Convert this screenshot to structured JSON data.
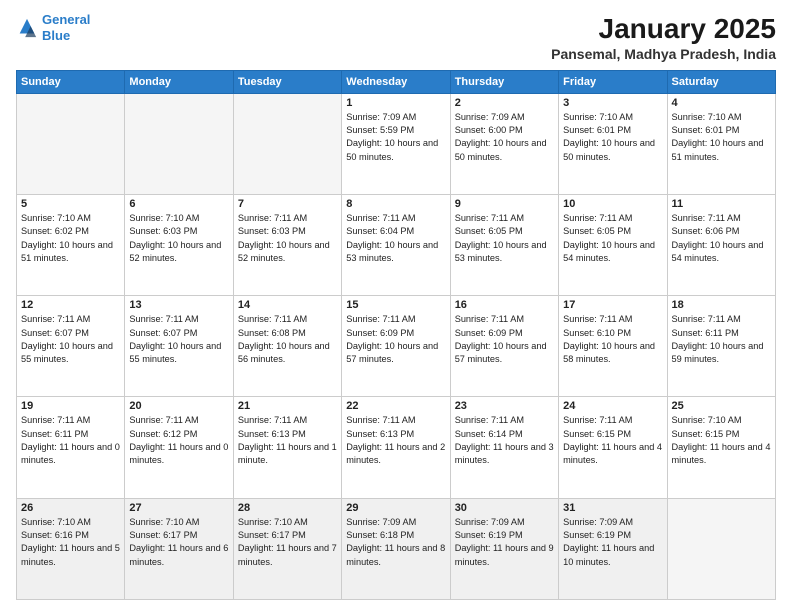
{
  "logo": {
    "line1": "General",
    "line2": "Blue"
  },
  "title": "January 2025",
  "location": "Pansemal, Madhya Pradesh, India",
  "weekdays": [
    "Sunday",
    "Monday",
    "Tuesday",
    "Wednesday",
    "Thursday",
    "Friday",
    "Saturday"
  ],
  "weeks": [
    [
      {
        "day": "",
        "empty": true
      },
      {
        "day": "",
        "empty": true
      },
      {
        "day": "",
        "empty": true
      },
      {
        "day": "1",
        "rise": "7:09 AM",
        "set": "5:59 PM",
        "daylight": "10 hours and 50 minutes."
      },
      {
        "day": "2",
        "rise": "7:09 AM",
        "set": "6:00 PM",
        "daylight": "10 hours and 50 minutes."
      },
      {
        "day": "3",
        "rise": "7:10 AM",
        "set": "6:01 PM",
        "daylight": "10 hours and 50 minutes."
      },
      {
        "day": "4",
        "rise": "7:10 AM",
        "set": "6:01 PM",
        "daylight": "10 hours and 51 minutes."
      }
    ],
    [
      {
        "day": "5",
        "rise": "7:10 AM",
        "set": "6:02 PM",
        "daylight": "10 hours and 51 minutes."
      },
      {
        "day": "6",
        "rise": "7:10 AM",
        "set": "6:03 PM",
        "daylight": "10 hours and 52 minutes."
      },
      {
        "day": "7",
        "rise": "7:11 AM",
        "set": "6:03 PM",
        "daylight": "10 hours and 52 minutes."
      },
      {
        "day": "8",
        "rise": "7:11 AM",
        "set": "6:04 PM",
        "daylight": "10 hours and 53 minutes."
      },
      {
        "day": "9",
        "rise": "7:11 AM",
        "set": "6:05 PM",
        "daylight": "10 hours and 53 minutes."
      },
      {
        "day": "10",
        "rise": "7:11 AM",
        "set": "6:05 PM",
        "daylight": "10 hours and 54 minutes."
      },
      {
        "day": "11",
        "rise": "7:11 AM",
        "set": "6:06 PM",
        "daylight": "10 hours and 54 minutes."
      }
    ],
    [
      {
        "day": "12",
        "rise": "7:11 AM",
        "set": "6:07 PM",
        "daylight": "10 hours and 55 minutes."
      },
      {
        "day": "13",
        "rise": "7:11 AM",
        "set": "6:07 PM",
        "daylight": "10 hours and 55 minutes."
      },
      {
        "day": "14",
        "rise": "7:11 AM",
        "set": "6:08 PM",
        "daylight": "10 hours and 56 minutes."
      },
      {
        "day": "15",
        "rise": "7:11 AM",
        "set": "6:09 PM",
        "daylight": "10 hours and 57 minutes."
      },
      {
        "day": "16",
        "rise": "7:11 AM",
        "set": "6:09 PM",
        "daylight": "10 hours and 57 minutes."
      },
      {
        "day": "17",
        "rise": "7:11 AM",
        "set": "6:10 PM",
        "daylight": "10 hours and 58 minutes."
      },
      {
        "day": "18",
        "rise": "7:11 AM",
        "set": "6:11 PM",
        "daylight": "10 hours and 59 minutes."
      }
    ],
    [
      {
        "day": "19",
        "rise": "7:11 AM",
        "set": "6:11 PM",
        "daylight": "11 hours and 0 minutes."
      },
      {
        "day": "20",
        "rise": "7:11 AM",
        "set": "6:12 PM",
        "daylight": "11 hours and 0 minutes."
      },
      {
        "day": "21",
        "rise": "7:11 AM",
        "set": "6:13 PM",
        "daylight": "11 hours and 1 minute."
      },
      {
        "day": "22",
        "rise": "7:11 AM",
        "set": "6:13 PM",
        "daylight": "11 hours and 2 minutes."
      },
      {
        "day": "23",
        "rise": "7:11 AM",
        "set": "6:14 PM",
        "daylight": "11 hours and 3 minutes."
      },
      {
        "day": "24",
        "rise": "7:11 AM",
        "set": "6:15 PM",
        "daylight": "11 hours and 4 minutes."
      },
      {
        "day": "25",
        "rise": "7:10 AM",
        "set": "6:15 PM",
        "daylight": "11 hours and 4 minutes."
      }
    ],
    [
      {
        "day": "26",
        "rise": "7:10 AM",
        "set": "6:16 PM",
        "daylight": "11 hours and 5 minutes.",
        "lastrow": true
      },
      {
        "day": "27",
        "rise": "7:10 AM",
        "set": "6:17 PM",
        "daylight": "11 hours and 6 minutes.",
        "lastrow": true
      },
      {
        "day": "28",
        "rise": "7:10 AM",
        "set": "6:17 PM",
        "daylight": "11 hours and 7 minutes.",
        "lastrow": true
      },
      {
        "day": "29",
        "rise": "7:09 AM",
        "set": "6:18 PM",
        "daylight": "11 hours and 8 minutes.",
        "lastrow": true
      },
      {
        "day": "30",
        "rise": "7:09 AM",
        "set": "6:19 PM",
        "daylight": "11 hours and 9 minutes.",
        "lastrow": true
      },
      {
        "day": "31",
        "rise": "7:09 AM",
        "set": "6:19 PM",
        "daylight": "11 hours and 10 minutes.",
        "lastrow": true
      },
      {
        "day": "",
        "empty": true,
        "lastrow": true
      }
    ]
  ]
}
